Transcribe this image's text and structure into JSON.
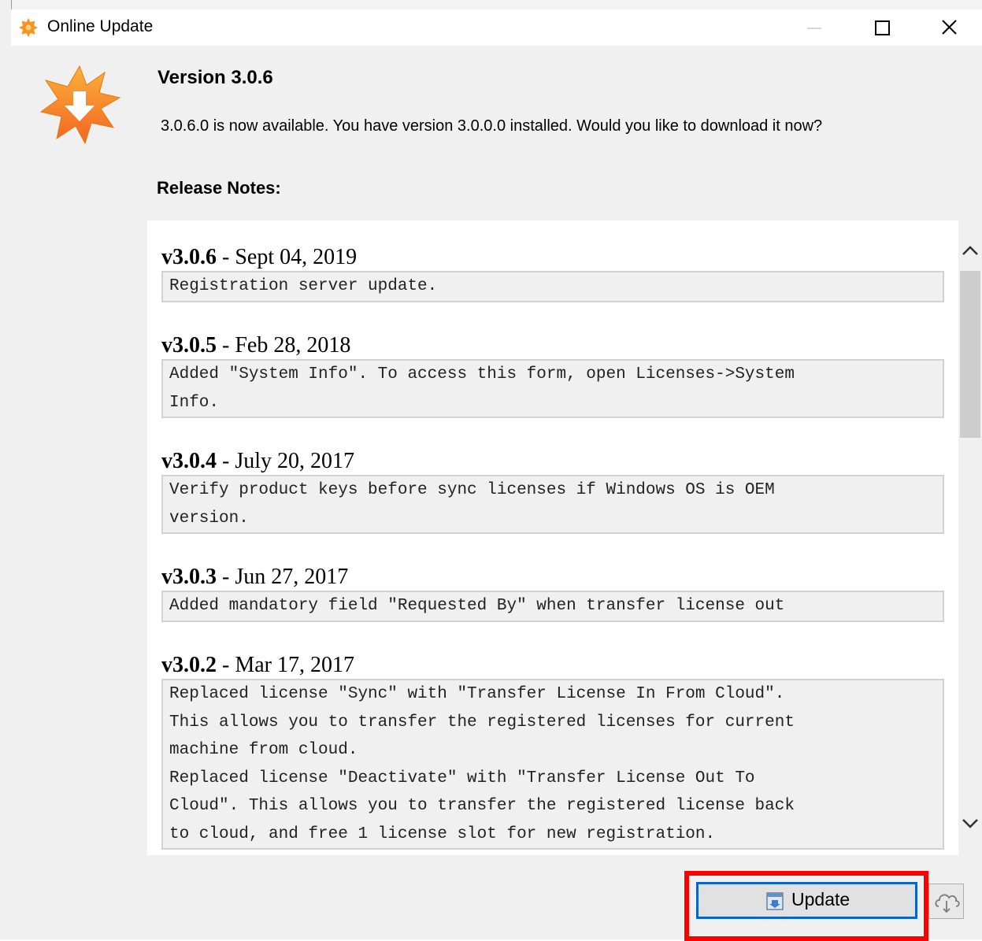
{
  "window": {
    "title": "Online Update"
  },
  "header": {
    "version_title": "Version 3.0.6",
    "available_message": "3.0.6.0 is now available. You have version 3.0.0.0 installed. Would you like to download it now?",
    "release_notes_label": "Release Notes:"
  },
  "release_notes": [
    {
      "version": "v3.0.6",
      "date": " - Sept 04, 2019",
      "body": "Registration server update."
    },
    {
      "version": "v3.0.5",
      "date": " - Feb 28, 2018",
      "body": "Added \"System Info\". To access this form, open Licenses->System\nInfo."
    },
    {
      "version": "v3.0.4",
      "date": " - July 20, 2017",
      "body": "Verify product keys before sync licenses if Windows OS is OEM\nversion."
    },
    {
      "version": "v3.0.3",
      "date": " - Jun 27, 2017",
      "body": "Added mandatory field \"Requested By\" when transfer license out"
    },
    {
      "version": "v3.0.2",
      "date": " - Mar 17, 2017",
      "body": "Replaced license \"Sync\" with \"Transfer License In From Cloud\".\nThis allows you to transfer the registered licenses for current\nmachine from cloud.\nReplaced license \"Deactivate\" with \"Transfer License Out To\nCloud\". This allows you to transfer the registered license back\nto cloud, and free 1 license slot for new registration."
    }
  ],
  "footer": {
    "update_label": "Update",
    "update_icon": "installer-package-icon",
    "cloud_icon": "cloud-download-icon"
  },
  "colors": {
    "highlight": "#ff0000",
    "focus_border": "#0a64c8",
    "badge_orange": "#f7941d"
  }
}
